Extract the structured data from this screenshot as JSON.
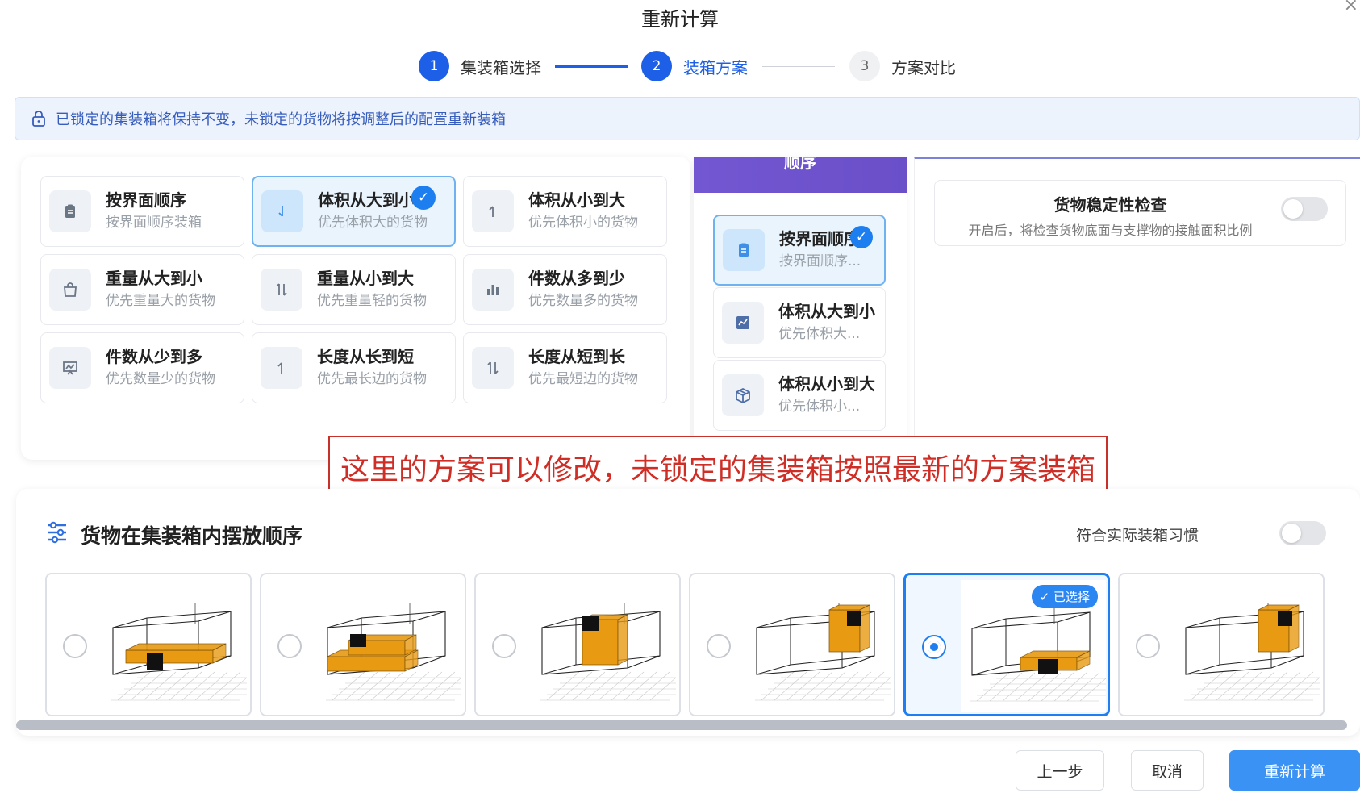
{
  "dialog": {
    "title": "重新计算",
    "close_glyph": "×"
  },
  "steps": [
    {
      "num": "1",
      "label": "集装箱选择",
      "state": "done"
    },
    {
      "num": "2",
      "label": "装箱方案",
      "state": "current"
    },
    {
      "num": "3",
      "label": "方案对比",
      "state": "todo"
    }
  ],
  "notice": {
    "icon": "lock-icon",
    "text": "已锁定的集装箱将保持不变，未锁定的货物将按调整后的配置重新装箱"
  },
  "sort_options": [
    {
      "title": "按界面顺序",
      "desc": "按界面顺序装箱",
      "icon": "clipboard-icon",
      "selected": false
    },
    {
      "title": "体积从大到小",
      "desc": "优先体积大的货物",
      "icon": "arrow-down-icon",
      "selected": true
    },
    {
      "title": "体积从小到大",
      "desc": "优先体积小的货物",
      "icon": "arrow-up-icon",
      "selected": false
    },
    {
      "title": "重量从大到小",
      "desc": "优先重量大的货物",
      "icon": "bag-icon",
      "selected": false
    },
    {
      "title": "重量从小到大",
      "desc": "优先重量轻的货物",
      "icon": "sort-arrows-icon",
      "selected": false
    },
    {
      "title": "件数从多到少",
      "desc": "优先数量多的货物",
      "icon": "bar-chart-icon",
      "selected": false
    },
    {
      "title": "件数从少到多",
      "desc": "优先数量少的货物",
      "icon": "presentation-icon",
      "selected": false
    },
    {
      "title": "长度从长到短",
      "desc": "优先最长边的货物",
      "icon": "arrow-up-icon",
      "selected": false
    },
    {
      "title": "长度从短到长",
      "desc": "优先最短边的货物",
      "icon": "sort-arrows-icon",
      "selected": false
    }
  ],
  "mid_panel": {
    "header": "顺序",
    "items": [
      {
        "title": "按界面顺序",
        "desc": "按界面顺序...",
        "icon": "clipboard-icon",
        "selected": true
      },
      {
        "title": "体积从大到小",
        "desc": "优先体积大...",
        "icon": "trend-icon",
        "selected": false
      },
      {
        "title": "体积从小到大",
        "desc": "优先体积小...",
        "icon": "box-icon",
        "selected": false
      }
    ]
  },
  "stability": {
    "title": "货物稳定性检查",
    "desc": "开启后，将检查货物底面与支撑物的接触面积比例",
    "enabled": false
  },
  "annotation": {
    "text": "这里的方案可以修改，未锁定的集装箱按照最新的方案装箱"
  },
  "placement": {
    "title": "货物在集装箱内摆放顺序",
    "habit_label": "符合实际装箱习惯",
    "habit_enabled": false,
    "selected_tag": "✓ 已选择",
    "options": [
      {
        "selected": false
      },
      {
        "selected": false
      },
      {
        "selected": false
      },
      {
        "selected": false
      },
      {
        "selected": true
      },
      {
        "selected": false
      }
    ]
  },
  "footer": {
    "prev": "上一步",
    "cancel": "取消",
    "recalc": "重新计算"
  },
  "colors": {
    "primary": "#1d5fe6",
    "accent_blue": "#1f7ff0",
    "cargo_orange": "#e89a12",
    "annotation_red": "#cf2e26"
  }
}
